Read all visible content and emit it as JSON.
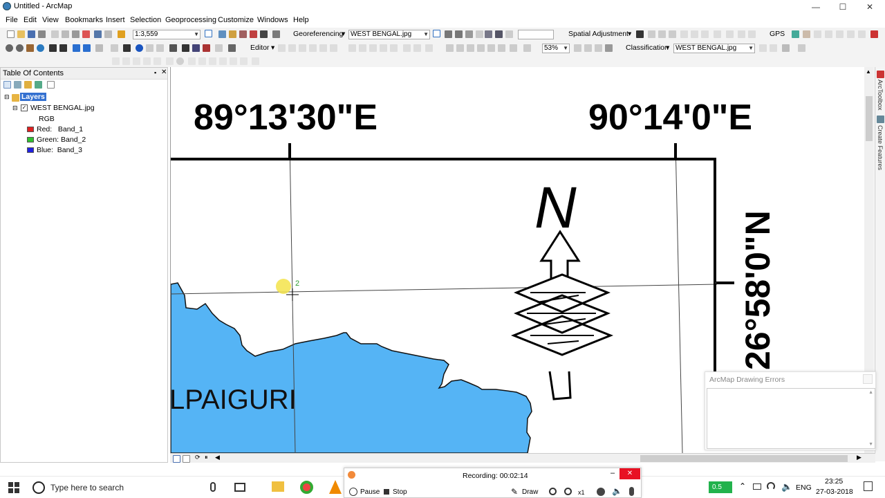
{
  "window": {
    "title": "Untitled - ArcMap",
    "minimize": "—",
    "maximize": "☐",
    "close": "✕"
  },
  "menu": {
    "items": [
      "File",
      "Edit",
      "View",
      "Bookmarks",
      "Insert",
      "Selection",
      "Geoprocessing",
      "Customize",
      "Windows",
      "Help"
    ]
  },
  "toolbar": {
    "scale": "1:3,559",
    "georef_label": "Georeferencing",
    "georef_layer": "WEST BENGAL.jpg",
    "spatial_adjustment": "Spatial Adjustment",
    "gps": "GPS",
    "editor": "Editor",
    "zoom": "53%",
    "classification": "Classification",
    "class_layer": "WEST BENGAL.jpg"
  },
  "toc": {
    "title": "Table Of Contents",
    "pin": "▪",
    "close": "✕",
    "layers_label": "Layers",
    "layer_name": "WEST BENGAL.jpg",
    "rgb_label": "RGB",
    "bands": [
      {
        "label": "Red:   Band_1",
        "color": "#e02020"
      },
      {
        "label": "Green: Band_2",
        "color": "#30c030"
      },
      {
        "label": "Blue:  Band_3",
        "color": "#2020e0"
      }
    ]
  },
  "map": {
    "lon_left": "89°13'30\"E",
    "lon_right": "90°14'0\"E",
    "lat_right": "26°58'0\"N",
    "place_label": "LPAIGURI",
    "north_label": "N",
    "control_point_label": "2",
    "water_color": "#55b4f5"
  },
  "sidebar": {
    "arctoolbox": "ArcToolbox",
    "create_features": "Create Features"
  },
  "error_window": {
    "title": "ArcMap Drawing Errors"
  },
  "recorder": {
    "status": "Recording:  00:02:14",
    "pause": "Pause",
    "stop": "Stop",
    "draw": "Draw",
    "zoom_level": "x1"
  },
  "taskbar": {
    "search_placeholder": "Type here to search",
    "battery": "0.5",
    "language": "ENG",
    "time": "23:25",
    "date": "27-03-2018"
  }
}
